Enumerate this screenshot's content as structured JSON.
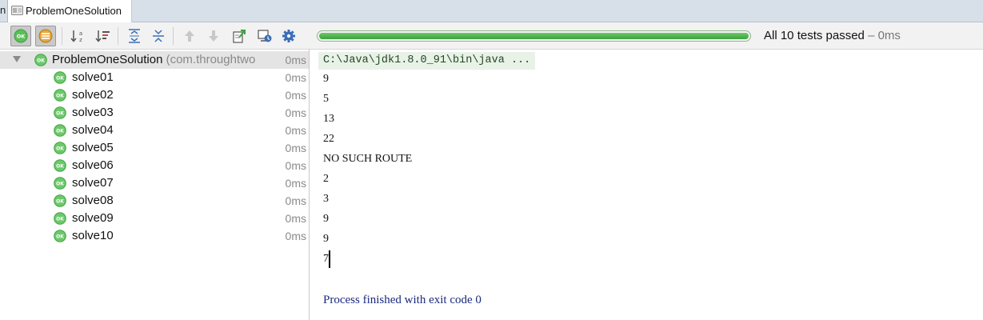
{
  "tab": {
    "left_fragment": "n",
    "title": "ProblemOneSolution"
  },
  "toolbar": {
    "buttons": [
      "show-passed-icon",
      "show-ignored-icon",
      "sort-alphabetically-icon",
      "sort-by-duration-icon",
      "expand-all-icon",
      "collapse-all-icon",
      "previous-failed-icon",
      "next-failed-icon",
      "export-results-icon",
      "import-results-icon",
      "settings-icon"
    ],
    "progress": 1.0,
    "status_main": "All 10 tests passed",
    "status_time": " – 0ms"
  },
  "tree": {
    "root": {
      "name": "ProblemOneSolution",
      "package": " (com.throughtwo",
      "time": "0ms"
    },
    "tests": [
      {
        "name": "solve01",
        "time": "0ms"
      },
      {
        "name": "solve02",
        "time": "0ms"
      },
      {
        "name": "solve03",
        "time": "0ms"
      },
      {
        "name": "solve04",
        "time": "0ms"
      },
      {
        "name": "solve05",
        "time": "0ms"
      },
      {
        "name": "solve06",
        "time": "0ms"
      },
      {
        "name": "solve07",
        "time": "0ms"
      },
      {
        "name": "solve08",
        "time": "0ms"
      },
      {
        "name": "solve09",
        "time": "0ms"
      },
      {
        "name": "solve10",
        "time": "0ms"
      }
    ]
  },
  "console": {
    "command": "C:\\Java\\jdk1.8.0_91\\bin\\java ...",
    "lines": [
      "9",
      "5",
      "13",
      "22",
      "NO SUCH ROUTE",
      "2",
      "3",
      "9",
      "9",
      "7"
    ],
    "exit_message": "Process finished with exit code 0"
  },
  "colors": {
    "pass_green": "#4caf50",
    "progress_green": "#3aa33c",
    "exit_blue": "#1a2a7e"
  }
}
